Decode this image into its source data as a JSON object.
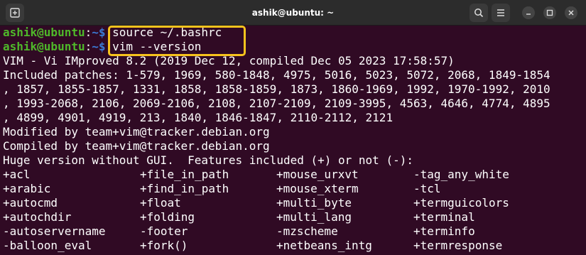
{
  "window": {
    "title": "ashik@ubuntu: ~",
    "icons": {
      "new_tab": "new-tab-icon",
      "search": "search-icon",
      "menu": "hamburger-menu-icon",
      "minimize": "minimize-icon",
      "maximize": "maximize-icon",
      "close": "close-icon"
    }
  },
  "prompt": {
    "user": "ashik@ubuntu",
    "colon": ":",
    "path": "~$"
  },
  "commands": [
    " source ~/.bashrc",
    " vim --version"
  ],
  "output": {
    "version": "VIM - Vi IMproved 8.2 (2019 Dec 12, compiled Dec 05 2023 17:58:57)",
    "patches": [
      "Included patches: 1-579, 1969, 580-1848, 4975, 5016, 5023, 5072, 2068, 1849-1854",
      ", 1857, 1855-1857, 1331, 1858, 1858-1859, 1873, 1860-1969, 1992, 1970-1992, 2010",
      ", 1993-2068, 2106, 2069-2106, 2108, 2107-2109, 2109-3995, 4563, 4646, 4774, 4895",
      ", 4899, 4901, 4919, 213, 1840, 1846-1847, 2110-2112, 2121"
    ],
    "modified_by": "Modified by team+vim@tracker.debian.org",
    "compiled_by": "Compiled by team+vim@tracker.debian.org",
    "features_header": "Huge version without GUI.  Features included (+) or not (-):",
    "features": [
      [
        "+acl",
        "+file_in_path",
        "+mouse_urxvt",
        "-tag_any_white"
      ],
      [
        "+arabic",
        "+find_in_path",
        "+mouse_xterm",
        "-tcl"
      ],
      [
        "+autocmd",
        "+float",
        "+multi_byte",
        "+termguicolors"
      ],
      [
        "+autochdir",
        "+folding",
        "+multi_lang",
        "+terminal"
      ],
      [
        "-autoservername",
        "-footer",
        "-mzscheme",
        "+terminfo"
      ],
      [
        "-balloon_eval",
        "+fork()",
        "+netbeans_intg",
        "+termresponse"
      ]
    ]
  },
  "highlight_color": "#f6c31d"
}
